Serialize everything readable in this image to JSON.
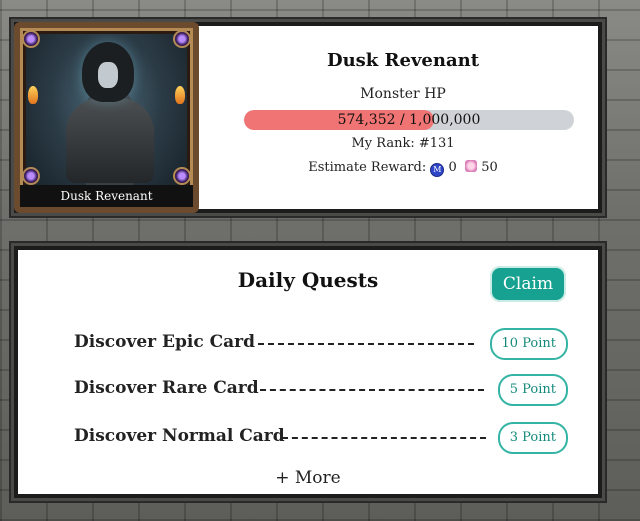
{
  "boss": {
    "card_name": "Dusk Revenant",
    "title": "Dusk Revenant",
    "hp_label": "Monster HP",
    "hp_current": 574352,
    "hp_max": 1000000,
    "hp_text": "574,352 / 1,000,000",
    "rank": "My Rank: #131",
    "reward_label": "Estimate Reward:",
    "reward_coin": "0",
    "reward_gift": "50"
  },
  "quests": {
    "title": "Daily Quests",
    "claim_label": "Claim",
    "items": [
      {
        "name": "Discover Epic Card",
        "points": "10 Point"
      },
      {
        "name": "Discover Rare Card",
        "points": "5 Point"
      },
      {
        "name": "Discover Normal Card",
        "points": "3 Point"
      }
    ],
    "more_label": "+ More"
  },
  "colors": {
    "accent": "#16a190",
    "hp_fill": "#f07474",
    "hp_track": "#cfd3d8"
  }
}
